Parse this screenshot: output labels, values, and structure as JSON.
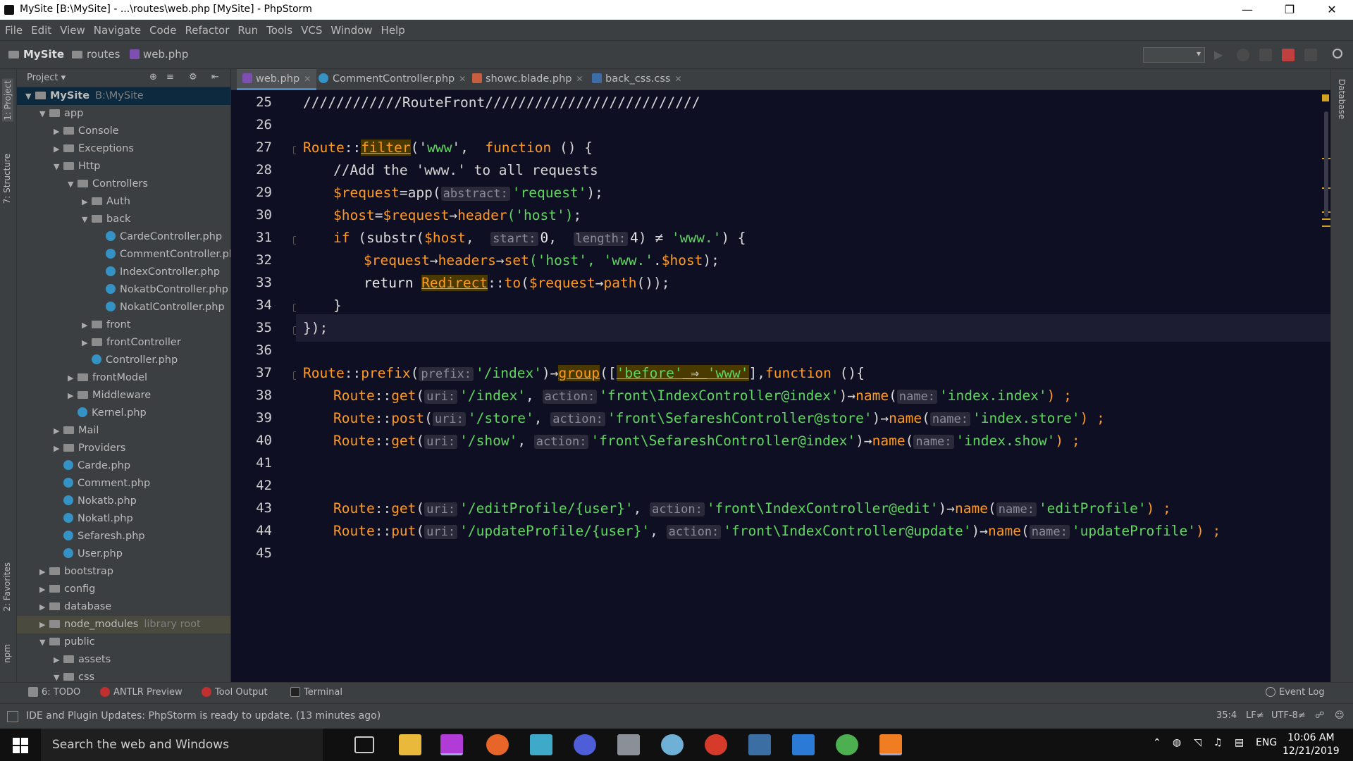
{
  "window": {
    "title": "MySite [B:\\MySite] - ...\\routes\\web.php [MySite] - PhpStorm"
  },
  "menu": [
    "File",
    "Edit",
    "View",
    "Navigate",
    "Code",
    "Refactor",
    "Run",
    "Tools",
    "VCS",
    "Window",
    "Help"
  ],
  "breadcrumb": {
    "project": "MySite",
    "folder": "routes",
    "file": "web.php"
  },
  "project_panel": {
    "title": "Project",
    "tree": [
      {
        "label": "MySite",
        "extra": "B:\\MySite",
        "depth": 0,
        "type": "folder",
        "open": true,
        "selected": true
      },
      {
        "label": "app",
        "depth": 1,
        "type": "folder",
        "open": true
      },
      {
        "label": "Console",
        "depth": 2,
        "type": "folder"
      },
      {
        "label": "Exceptions",
        "depth": 2,
        "type": "folder"
      },
      {
        "label": "Http",
        "depth": 2,
        "type": "folder",
        "open": true
      },
      {
        "label": "Controllers",
        "depth": 3,
        "type": "folder",
        "open": true
      },
      {
        "label": "Auth",
        "depth": 4,
        "type": "folder"
      },
      {
        "label": "back",
        "depth": 4,
        "type": "folder",
        "open": true
      },
      {
        "label": "CardeController.php",
        "depth": 5,
        "type": "class"
      },
      {
        "label": "CommentController.php",
        "depth": 5,
        "type": "class"
      },
      {
        "label": "IndexController.php",
        "depth": 5,
        "type": "class"
      },
      {
        "label": "NokatbController.php",
        "depth": 5,
        "type": "class"
      },
      {
        "label": "NokatlController.php",
        "depth": 5,
        "type": "class"
      },
      {
        "label": "front",
        "depth": 4,
        "type": "folder"
      },
      {
        "label": "frontController",
        "depth": 4,
        "type": "folder"
      },
      {
        "label": "Controller.php",
        "depth": 4,
        "type": "class"
      },
      {
        "label": "frontModel",
        "depth": 3,
        "type": "folder"
      },
      {
        "label": "Middleware",
        "depth": 3,
        "type": "folder"
      },
      {
        "label": "Kernel.php",
        "depth": 3,
        "type": "class"
      },
      {
        "label": "Mail",
        "depth": 2,
        "type": "folder"
      },
      {
        "label": "Providers",
        "depth": 2,
        "type": "folder"
      },
      {
        "label": "Carde.php",
        "depth": 2,
        "type": "class"
      },
      {
        "label": "Comment.php",
        "depth": 2,
        "type": "class"
      },
      {
        "label": "Nokatb.php",
        "depth": 2,
        "type": "class"
      },
      {
        "label": "Nokatl.php",
        "depth": 2,
        "type": "class"
      },
      {
        "label": "Sefaresh.php",
        "depth": 2,
        "type": "class"
      },
      {
        "label": "User.php",
        "depth": 2,
        "type": "class"
      },
      {
        "label": "bootstrap",
        "depth": 1,
        "type": "folder"
      },
      {
        "label": "config",
        "depth": 1,
        "type": "folder"
      },
      {
        "label": "database",
        "depth": 1,
        "type": "folder"
      },
      {
        "label": "node_modules",
        "extra": "library root",
        "depth": 1,
        "type": "folder",
        "lib": true
      },
      {
        "label": "public",
        "depth": 1,
        "type": "folder",
        "open": true
      },
      {
        "label": "assets",
        "depth": 2,
        "type": "folder"
      },
      {
        "label": "css",
        "depth": 2,
        "type": "folder",
        "open": true
      }
    ]
  },
  "left_strip": {
    "project": "1: Project",
    "structure": "7: Structure",
    "favorites": "2: Favorites",
    "npm": "npm"
  },
  "right_strip": {
    "database": "Database"
  },
  "tabs": [
    {
      "label": "web.php",
      "active": true
    },
    {
      "label": "CommentController.php"
    },
    {
      "label": "showc.blade.php"
    },
    {
      "label": "back_css.css"
    }
  ],
  "editor": {
    "current_line": 35,
    "lines": [
      {
        "n": "25"
      },
      {
        "n": "26"
      },
      {
        "n": "27"
      },
      {
        "n": "28"
      },
      {
        "n": "29"
      },
      {
        "n": "30"
      },
      {
        "n": "31"
      },
      {
        "n": "32"
      },
      {
        "n": "33"
      },
      {
        "n": "34"
      },
      {
        "n": "35"
      },
      {
        "n": "36"
      },
      {
        "n": "37"
      },
      {
        "n": "38"
      },
      {
        "n": "39"
      },
      {
        "n": "40"
      },
      {
        "n": "41"
      },
      {
        "n": "42"
      },
      {
        "n": "43"
      },
      {
        "n": "44"
      },
      {
        "n": "45"
      }
    ],
    "code": {
      "l25": "////////////RouteFront//////////////////////////",
      "l27_a": "Route",
      "l27_b": "::",
      "l27_c": "filter",
      "l27_d": "('",
      "l27_e": "www",
      "l27_f": "',  ",
      "l27_g": "function",
      "l27_h": " () {",
      "l28": "//Add the 'www.' to all requests",
      "l29_a": "$request",
      "l29_b": "=app(",
      "l29_h": "abstract:",
      "l29_s": "'request'",
      "l29_e": ");",
      "l30_a": "$host",
      "l30_b": "=",
      "l30_c": "$request",
      "l30_d": "→",
      "l30_e": "header",
      "l30_s": "('host')",
      "l30_f": ";",
      "l31_a": "if",
      "l31_b": " (substr(",
      "l31_c": "$host",
      "l31_d": ",  ",
      "l31_h1": "start:",
      "l31_e": "0",
      "l31_f": ",  ",
      "l31_h2": "length:",
      "l31_g": "4",
      "l31_i": ") ≠ ",
      "l31_s": "'www.'",
      "l31_j": ") {",
      "l32_a": "$request",
      "l32_b": "→",
      "l32_c": "headers",
      "l32_d": "→",
      "l32_e": "set",
      "l32_s1": "('host', ",
      "l32_s2": "'www.'",
      "l32_f": ".",
      "l32_g": "$host",
      "l32_h": ");",
      "l33_a": "return ",
      "l33_b": "Redirect",
      "l33_c": "::",
      "l33_d": "to",
      "l33_e": "(",
      "l33_f": "$request",
      "l33_g": "→",
      "l33_h": "path",
      "l33_i": "());",
      "l34": "}",
      "l35": "});",
      "l37_a": "Route",
      "l37_b": "::",
      "l37_c": "prefix",
      "l37_d": "(",
      "l37_h": "prefix:",
      "l37_s": "'/index'",
      "l37_e": ")→",
      "l37_f": "group",
      "l37_g": "([",
      "l37_s2": "'before'",
      "l37_i": " ⇒ ",
      "l37_s3": "'www'",
      "l37_j": "],",
      "l37_k": "function",
      "l37_l": " (){",
      "l38_a": "Route",
      "l38_b": "::",
      "l38_c": "get",
      "l38_d": "(",
      "l38_h1": "uri:",
      "l38_s1": "'/index'",
      "l38_e": ", ",
      "l38_h2": "action:",
      "l38_s2": "'front\\IndexController@index'",
      "l38_f": ")→",
      "l38_g": "name",
      "l38_i": "(",
      "l38_h3": "name:",
      "l38_s3": "'index.index'",
      "l38_j": ") ;",
      "l39_a": "Route",
      "l39_b": "::",
      "l39_c": "post",
      "l39_d": "(",
      "l39_h1": "uri:",
      "l39_s1": "'/store'",
      "l39_e": ", ",
      "l39_h2": "action:",
      "l39_s2": "'front\\SefareshController@store'",
      "l39_f": ")→",
      "l39_g": "name",
      "l39_i": "(",
      "l39_h3": "name:",
      "l39_s3": "'index.store'",
      "l39_j": ") ;",
      "l40_a": "Route",
      "l40_b": "::",
      "l40_c": "get",
      "l40_d": "(",
      "l40_h1": "uri:",
      "l40_s1": "'/show'",
      "l40_e": ", ",
      "l40_h2": "action:",
      "l40_s2": "'front\\SefareshController@index'",
      "l40_f": ")→",
      "l40_g": "name",
      "l40_i": "(",
      "l40_h3": "name:",
      "l40_s3": "'index.show'",
      "l40_j": ") ;",
      "l43_a": "Route",
      "l43_b": "::",
      "l43_c": "get",
      "l43_d": "(",
      "l43_h1": "uri:",
      "l43_s1": "'/editProfile/{user}'",
      "l43_e": ", ",
      "l43_h2": "action:",
      "l43_s2": "'front\\IndexController@edit'",
      "l43_f": ")→",
      "l43_g": "name",
      "l43_i": "(",
      "l43_h3": "name:",
      "l43_s3": "'editProfile'",
      "l43_j": ") ;",
      "l44_a": "Route",
      "l44_b": "::",
      "l44_c": "put",
      "l44_d": "(",
      "l44_h1": "uri:",
      "l44_s1": "'/updateProfile/{user}'",
      "l44_e": ", ",
      "l44_h2": "action:",
      "l44_s2": "'front\\IndexController@update'",
      "l44_f": ")→",
      "l44_g": "name",
      "l44_i": "(",
      "l44_h3": "name:",
      "l44_s3": "'updateProfile'",
      "l44_j": ") ;"
    }
  },
  "bottom_tools": {
    "todo": "6: TODO",
    "antlr": "ANTLR Preview",
    "tool_output": "Tool Output",
    "terminal": "Terminal",
    "event_log": "Event Log"
  },
  "status": {
    "message": "IDE and Plugin Updates: PhpStorm is ready to update. (13 minutes ago)",
    "position": "35:4",
    "line_sep": "LF≠",
    "encoding": "UTF-8≠"
  },
  "taskbar": {
    "search_placeholder": "Search the web and Windows",
    "lang": "ENG",
    "time": "10:06 AM",
    "date": "12/21/2019"
  },
  "colors": {
    "editor_bg": "#0f0f23",
    "keyword": "#ff9a20",
    "string": "#5fd75f",
    "accent": "#4a88c7"
  }
}
